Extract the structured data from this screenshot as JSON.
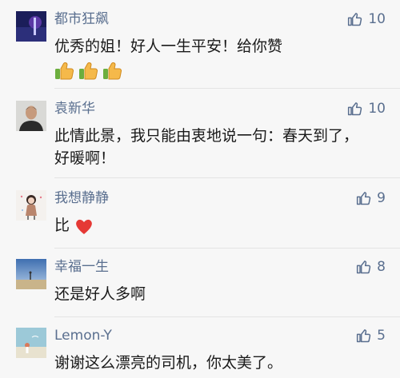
{
  "comments": [
    {
      "name": "都市狂飙",
      "likes": "10",
      "text": "优秀的姐！好人一生平安！给你赞"
    },
    {
      "name": "袁新华",
      "likes": "10",
      "text_line1": "此情此景，我只能由衷地说一句：春天到了，",
      "text_line2": "好暖啊！"
    },
    {
      "name": "我想静静",
      "likes": "9",
      "text": "比"
    },
    {
      "name": "幸福一生",
      "likes": "8",
      "text": "还是好人多啊"
    },
    {
      "name": "Lemon-Y",
      "likes": "5",
      "text": "谢谢这么漂亮的司机，你太美了。"
    }
  ],
  "icons": {
    "like": "thumbs-up-outline-icon",
    "emoji_thumbs": "thumbs-up-emoji",
    "emoji_heart": "red-heart-emoji"
  },
  "colors": {
    "name": "#5a6f8f",
    "text": "#1a1a1a",
    "background": "#f7f7f7",
    "heart": "#e53935",
    "thumb": "#f5b94a"
  }
}
